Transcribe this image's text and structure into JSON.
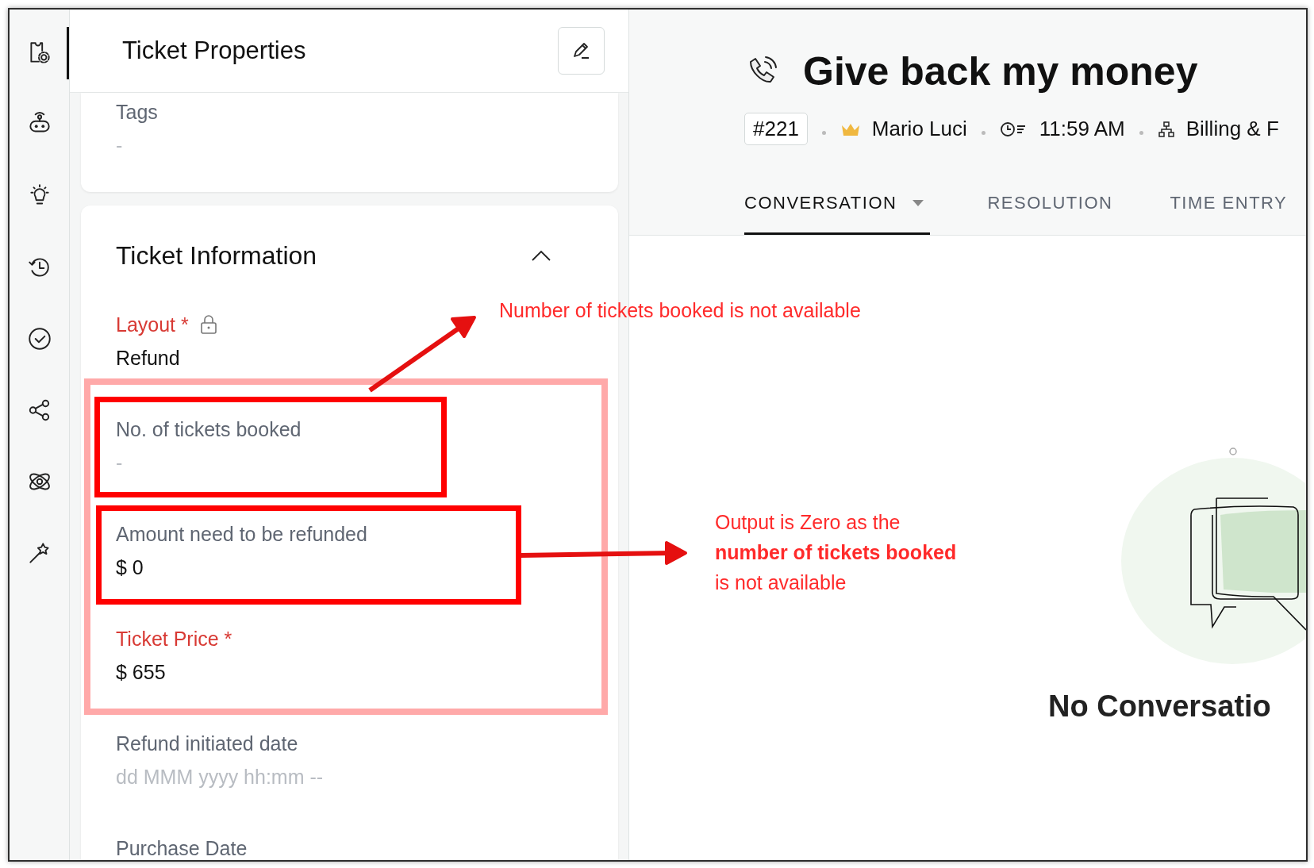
{
  "sidebar": {
    "items": [
      {
        "selected": true
      },
      {
        "selected": false
      },
      {
        "selected": false
      },
      {
        "selected": false
      },
      {
        "selected": false
      },
      {
        "selected": false
      },
      {
        "selected": false
      },
      {
        "selected": false
      }
    ]
  },
  "properties_panel": {
    "title": "Ticket Properties",
    "sections": [
      {
        "fields": [
          {
            "label": "Tags",
            "required": false,
            "locked": false,
            "value": "-",
            "empty": true
          }
        ]
      },
      {
        "title": "Ticket Information",
        "expanded": true,
        "fields": [
          {
            "label": "Layout *",
            "required": true,
            "locked": true,
            "value": "Refund",
            "empty": false
          },
          {
            "label": "No. of tickets booked",
            "required": false,
            "locked": false,
            "value": "-",
            "empty": true
          },
          {
            "label": "Amount need to be refunded",
            "required": false,
            "locked": false,
            "value": "$ 0",
            "empty": false
          },
          {
            "label": "Ticket Price *",
            "required": true,
            "locked": false,
            "value": "$ 655",
            "empty": false
          },
          {
            "label": "Refund initiated date",
            "required": false,
            "locked": false,
            "value": "dd MMM yyyy hh:mm --",
            "empty": true
          },
          {
            "label": "Purchase Date",
            "required": false,
            "locked": false
          }
        ]
      }
    ]
  },
  "ticket": {
    "title": "Give back my money",
    "number": "#221",
    "contact": "Mario Luci",
    "time": "11:59 AM",
    "department": "Billing & F",
    "tabs": [
      {
        "label": "CONVERSATION",
        "selected": true,
        "dropdown": true
      },
      {
        "label": "RESOLUTION",
        "selected": false,
        "dropdown": false
      },
      {
        "label": "TIME ENTRY",
        "selected": false,
        "dropdown": false
      }
    ],
    "empty_state": {
      "title": "No Conversatio"
    }
  },
  "annotations": {
    "notes": [
      {
        "lines": [
          "Number of tickets booked is not available"
        ]
      },
      {
        "lines": [
          "Output is Zero as the",
          "**number of tickets booked**",
          "is not available"
        ]
      }
    ]
  }
}
